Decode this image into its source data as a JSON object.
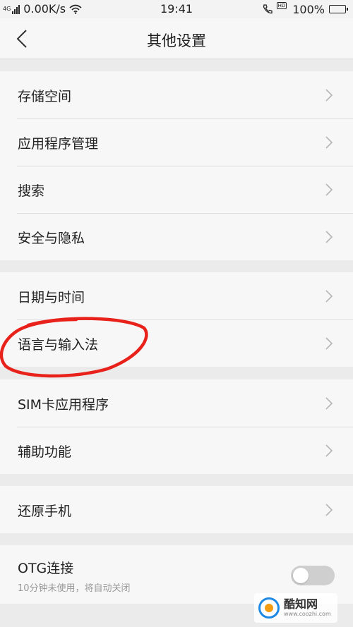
{
  "status_bar": {
    "net_type": "4G",
    "speed": "0.00K/s",
    "time": "19:41",
    "call_badge": "HD",
    "battery": "100%",
    "battery_level": 1.0
  },
  "nav": {
    "title": "其他设置"
  },
  "groups": [
    {
      "items": [
        {
          "label": "存储空间"
        },
        {
          "label": "应用程序管理"
        },
        {
          "label": "搜索"
        },
        {
          "label": "安全与隐私"
        }
      ]
    },
    {
      "items": [
        {
          "label": "日期与时间"
        },
        {
          "label": "语言与输入法"
        }
      ]
    },
    {
      "items": [
        {
          "label": "SIM卡应用程序"
        },
        {
          "label": "辅助功能"
        }
      ]
    },
    {
      "items": [
        {
          "label": "还原手机"
        }
      ]
    },
    {
      "items": [
        {
          "label": "OTG连接",
          "subtitle": "10分钟未使用，将自动关闭",
          "toggle_on": false
        }
      ]
    }
  ],
  "icons": {
    "back": "chevron-left-icon",
    "chevron": "chevron-right-icon",
    "wifi": "wifi-icon",
    "signal": "signal-icon",
    "call": "hd-call-icon",
    "battery": "battery-icon"
  },
  "colors": {
    "annotation": "#e8211a",
    "toggle_off": "#cfcfcf",
    "page_bg": "#ebebeb",
    "card_bg": "#f7f7f7"
  },
  "watermark": {
    "brand": "酷知网",
    "url": "www.coozhi.com"
  }
}
